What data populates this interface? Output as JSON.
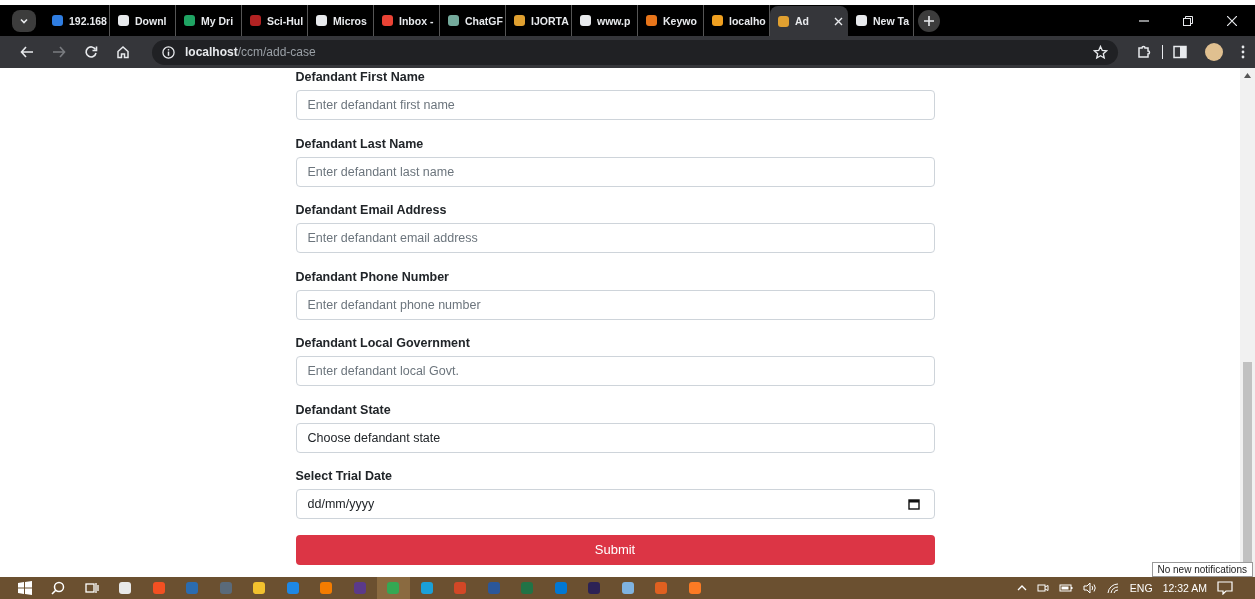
{
  "browser": {
    "tabs": [
      {
        "title": "192.168",
        "color": "#2f7de1",
        "selected": false,
        "closable": false
      },
      {
        "title": "Downl",
        "color": "#e8eaed",
        "selected": false,
        "closable": false
      },
      {
        "title": "My Dri",
        "color": "#1fa463",
        "selected": false,
        "closable": false
      },
      {
        "title": "Sci-Hul",
        "color": "#b22222",
        "selected": false,
        "closable": false
      },
      {
        "title": "Micros",
        "color": "#e8eaed",
        "selected": false,
        "closable": false
      },
      {
        "title": "Inbox -",
        "color": "#ea4335",
        "selected": false,
        "closable": false
      },
      {
        "title": "ChatGF",
        "color": "#74aa9c",
        "selected": false,
        "closable": false
      },
      {
        "title": "IJORTA",
        "color": "#e0a030",
        "selected": false,
        "closable": false
      },
      {
        "title": "www.p",
        "color": "#e8eaed",
        "selected": false,
        "closable": false
      },
      {
        "title": "Keywo",
        "color": "#e8751a",
        "selected": false,
        "closable": false
      },
      {
        "title": "localho",
        "color": "#f0a020",
        "selected": false,
        "closable": false
      },
      {
        "title": "Ad",
        "color": "#e0a030",
        "selected": true,
        "closable": true
      },
      {
        "title": "New Ta",
        "color": "#e8eaed",
        "selected": false,
        "closable": false
      }
    ],
    "address": {
      "host": "localhost",
      "path": "/ccm/add-case"
    },
    "forward_disabled": true
  },
  "form": {
    "fields": [
      {
        "label": "Defandant First Name",
        "kind": "text",
        "placeholder": "Enter defandant first name"
      },
      {
        "label": "Defandant Last Name",
        "kind": "text",
        "placeholder": "Enter defandant last name"
      },
      {
        "label": "Defandant Email Address",
        "kind": "text",
        "placeholder": "Enter defandant email address"
      },
      {
        "label": "Defandant Phone Number",
        "kind": "text",
        "placeholder": "Enter defandant phone number"
      },
      {
        "label": "Defandant Local Government",
        "kind": "text",
        "placeholder": "Enter defandant local Govt."
      },
      {
        "label": "Defandant State",
        "kind": "select",
        "value": "Choose defandant state"
      },
      {
        "label": "Select Trial Date",
        "kind": "date",
        "value": "dd/mm/yyyy"
      }
    ],
    "submit": "Submit"
  },
  "taskbar": {
    "apps": [
      {
        "kind": "start",
        "selected": false
      },
      {
        "kind": "search",
        "selected": false
      },
      {
        "kind": "taskview",
        "selected": false
      },
      {
        "kind": "app",
        "color": "#e8e8e8",
        "selected": false
      },
      {
        "kind": "app",
        "color": "#f25022",
        "selected": false
      },
      {
        "kind": "app",
        "color": "#2b6cb0",
        "selected": false
      },
      {
        "kind": "app",
        "color": "#5a6a7a",
        "selected": false
      },
      {
        "kind": "app",
        "color": "#f2c12e",
        "selected": false
      },
      {
        "kind": "app",
        "color": "#1e88e5",
        "selected": false
      },
      {
        "kind": "app",
        "color": "#f57c00",
        "selected": false
      },
      {
        "kind": "app",
        "color": "#5b3a8a",
        "selected": false
      },
      {
        "kind": "app",
        "color": "#34a853",
        "selected": true
      },
      {
        "kind": "app",
        "color": "#1aa0d8",
        "selected": false
      },
      {
        "kind": "app",
        "color": "#d24726",
        "selected": false
      },
      {
        "kind": "app",
        "color": "#2b579a",
        "selected": false
      },
      {
        "kind": "app",
        "color": "#217346",
        "selected": false
      },
      {
        "kind": "app",
        "color": "#0078d4",
        "selected": false
      },
      {
        "kind": "app",
        "color": "#2c2255",
        "selected": false
      },
      {
        "kind": "app",
        "color": "#7fb3e0",
        "selected": false
      },
      {
        "kind": "app",
        "color": "#e06020",
        "selected": false
      },
      {
        "kind": "app",
        "color": "#fb7a24",
        "selected": false
      }
    ],
    "language": "ENG",
    "time": "12:32 AM"
  },
  "tooltip": "No new notifications"
}
